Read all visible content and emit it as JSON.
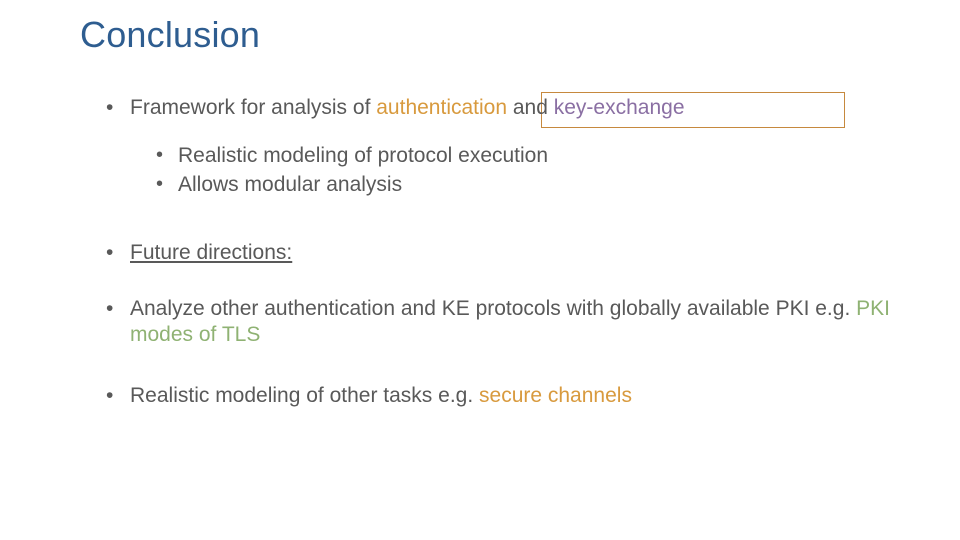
{
  "title": "Conclusion",
  "bullets": {
    "b1_pre": "Framework for analysis of ",
    "b1_auth": "authentication",
    "b1_mid": " and ",
    "b1_ke": "key-exchange",
    "sub1": "Realistic modeling of protocol execution",
    "sub2": "Allows modular analysis",
    "b2": "Future directions:",
    "b3_pre": "Analyze other authentication and KE protocols with globally available PKI e.g. ",
    "b3_hl": "PKI modes of TLS",
    "b4_pre": "Realistic modeling of other tasks e.g. ",
    "b4_hl": "secure channels"
  }
}
